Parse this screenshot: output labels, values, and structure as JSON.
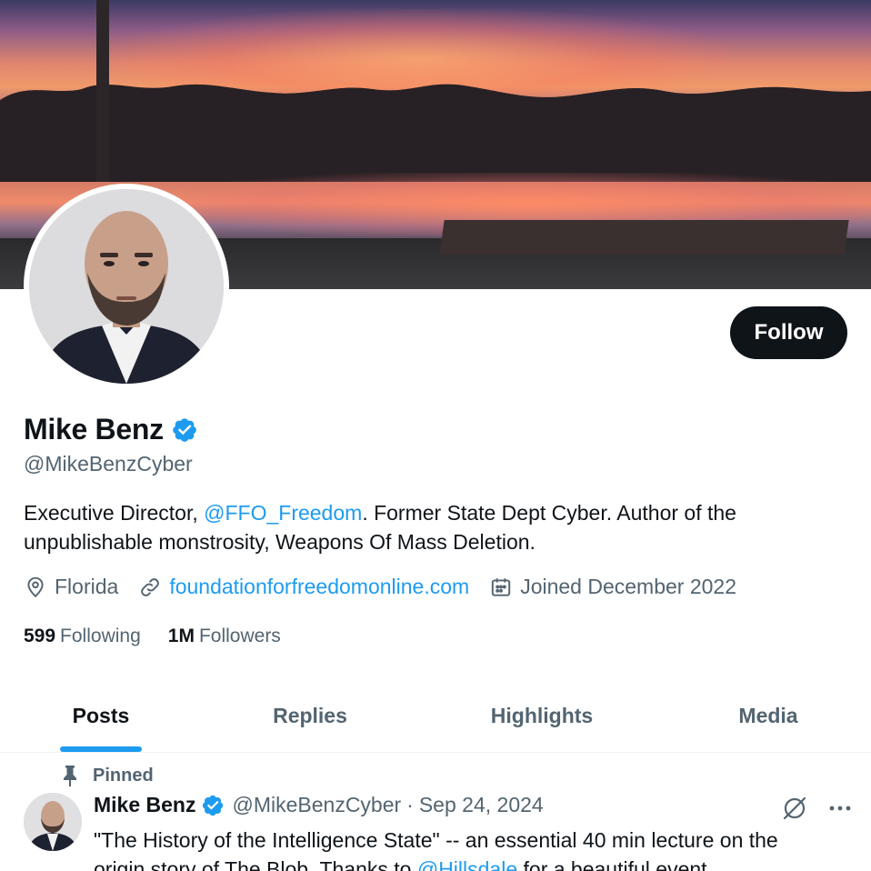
{
  "banner": {
    "description_icon": "sunset-lake-banner"
  },
  "profile": {
    "display_name": "Mike Benz",
    "handle": "@MikeBenzCyber",
    "verified": true,
    "follow_label": "Follow",
    "bio": {
      "part1": "Executive Director, ",
      "mention": "@FFO_Freedom",
      "part2": ". Former State Dept Cyber. Author of the unpublishable monstrosity, Weapons Of Mass Deletion."
    },
    "location": "Florida",
    "website": "foundationforfreedomonline.com",
    "joined": "Joined December 2022",
    "following_count": "599",
    "following_label": "Following",
    "followers_count": "1M",
    "followers_label": "Followers"
  },
  "tabs": [
    {
      "label": "Posts",
      "active": true
    },
    {
      "label": "Replies",
      "active": false
    },
    {
      "label": "Highlights",
      "active": false
    },
    {
      "label": "Media",
      "active": false
    }
  ],
  "pinned_post": {
    "pinned_label": "Pinned",
    "author_name": "Mike Benz",
    "author_handle": "@MikeBenzCyber",
    "separator": "·",
    "date": "Sep 24, 2024",
    "text_line1": "\"The History of the Intelligence State\" -- an essential 40 min lecture on the",
    "text_line2_a": "origin story of The Blob. Thanks to ",
    "text_line2_mention": "@Hillsdale",
    "text_line2_b": " for a beautiful event."
  },
  "colors": {
    "accent": "#1d9bf0",
    "text_primary": "#0f1419",
    "text_secondary": "#536471",
    "button_bg": "#0f1419"
  },
  "icons": {
    "location": "location-pin-icon",
    "link": "link-icon",
    "calendar": "calendar-icon",
    "pin": "pin-icon",
    "grok": "grok-icon",
    "more": "more-icon",
    "verified": "verified-badge-icon"
  }
}
